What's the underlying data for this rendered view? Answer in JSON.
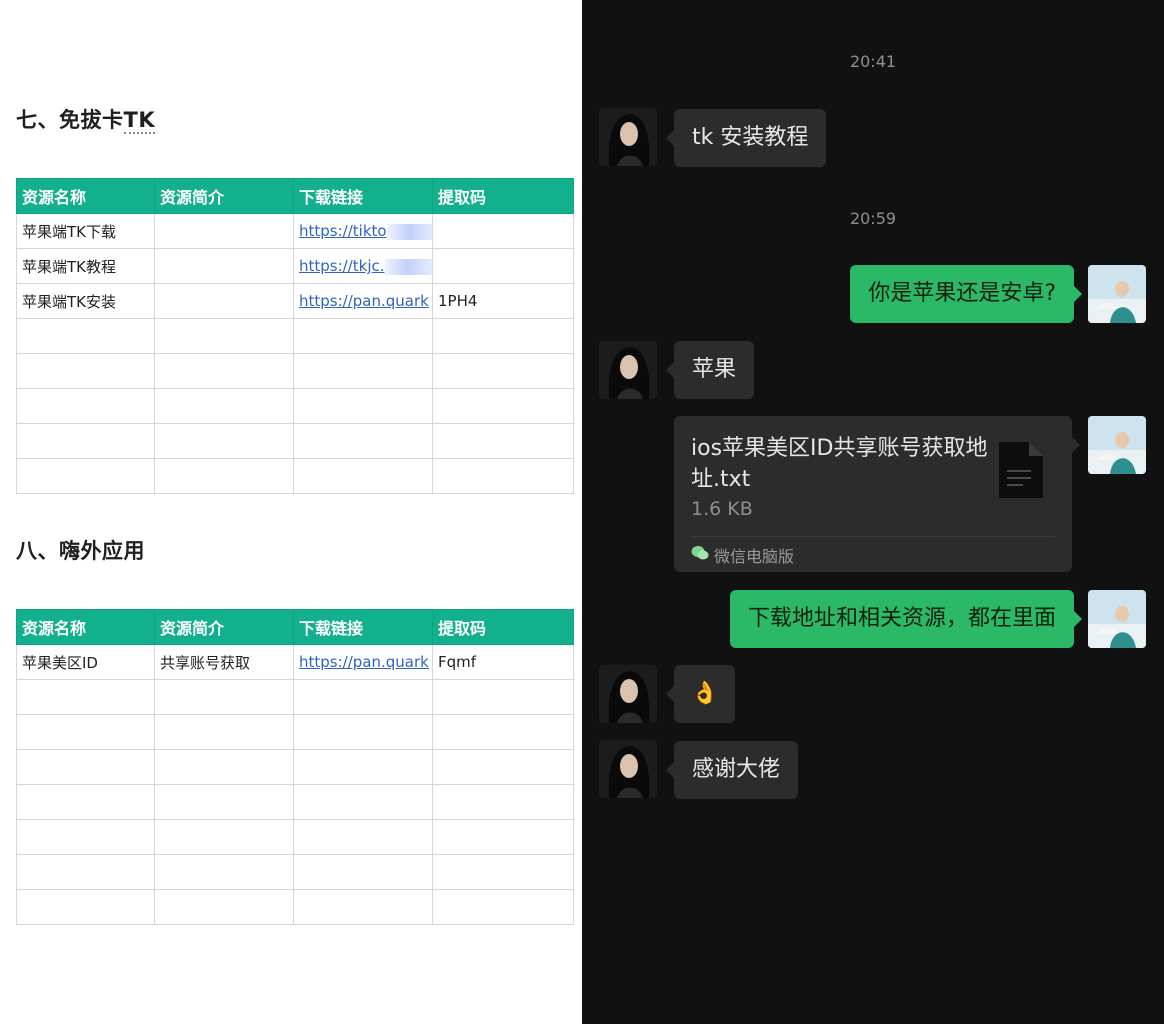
{
  "doc": {
    "section7": {
      "title_prefix": "七、免拔卡",
      "title_suffix": "TK",
      "headers": [
        "资源名称",
        "资源简介",
        "下载链接",
        "提取码"
      ],
      "rows": [
        {
          "name": "苹果端TK下载",
          "desc": "",
          "link_start": "https://tikto",
          "link_end": "/",
          "code": ""
        },
        {
          "name": "苹果端TK教程",
          "desc": "",
          "link_start": "https://tkjc.",
          "link_end": "/",
          "code": ""
        },
        {
          "name": "苹果端TK安装",
          "desc": "",
          "link": "https://pan.quark",
          "code": "1PH4"
        }
      ]
    },
    "section8": {
      "title": "八、嗨外应用",
      "headers": [
        "资源名称",
        "资源简介",
        "下载链接",
        "提取码"
      ],
      "rows": [
        {
          "name": "苹果美区ID",
          "desc": "共享账号获取",
          "link": "https://pan.quark",
          "code": "Fqmf"
        }
      ]
    }
  },
  "chat": {
    "time1": "20:41",
    "time2": "20:59",
    "msg1": "tk 安装教程",
    "msg2": "你是苹果还是安卓?",
    "msg3": "苹果",
    "file": {
      "name": "ios苹果美区ID共享账号获取地址.txt",
      "size": "1.6 KB",
      "source": "微信电脑版"
    },
    "msg5": "下载地址和相关资源，都在里面",
    "msg6": "👌",
    "msg7": "感谢大佬"
  }
}
